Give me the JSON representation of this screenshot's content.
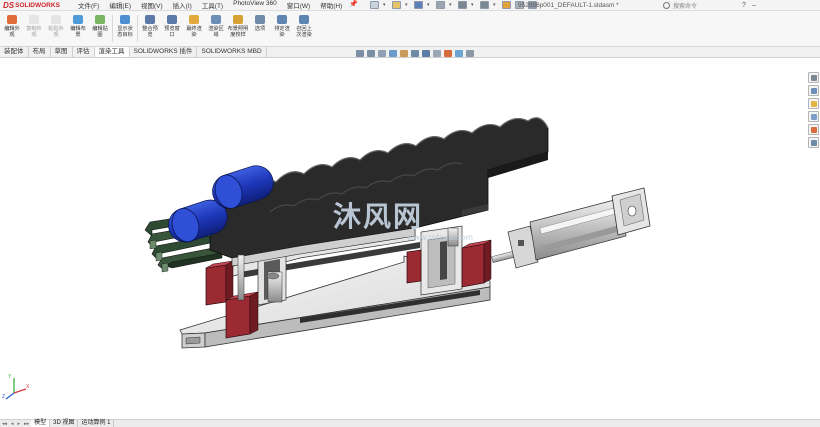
{
  "app": {
    "logo_ds": "DS",
    "logo_brand": "SOLIDWORKS",
    "document_title": "952006p001_DEFAULT-1.sldasm *",
    "search_placeholder": "搜索命令",
    "help_symbol": "?",
    "minimize_symbol": "–",
    "menu_pin_symbol": "📌"
  },
  "menu": [
    "文件(F)",
    "编辑(E)",
    "视图(V)",
    "插入(I)",
    "工具(T)",
    "PhotoView 360",
    "窗口(W)",
    "帮助(H)"
  ],
  "quick_access": [
    {
      "icon": "new-doc-icon",
      "color": "#c9d3de"
    },
    {
      "icon": "open-icon",
      "color": "#e7c36a"
    },
    {
      "icon": "save-icon",
      "color": "#5b7fb6"
    },
    {
      "icon": "print-icon",
      "color": "#9aa6b3"
    },
    {
      "icon": "undo-icon",
      "color": "#7b8793"
    },
    {
      "icon": "select-icon",
      "color": "#7b8793"
    },
    {
      "icon": "rebuild-icon",
      "color": "#e0a23a"
    },
    {
      "icon": "file-props-icon",
      "color": "#aab4bf"
    },
    {
      "icon": "options-icon",
      "color": "#8e9aa8"
    }
  ],
  "command_manager": [
    {
      "line1": "编辑外",
      "line2": "观",
      "icon": "edit-appearance-icon",
      "color": "#e06c3a",
      "enabled": true
    },
    {
      "line1": "复制外",
      "line2": "观",
      "icon": "copy-appearance-icon",
      "color": "#cfcfcf",
      "enabled": false
    },
    {
      "line1": "粘贴外",
      "line2": "观",
      "icon": "paste-appearance-icon",
      "color": "#cfcfcf",
      "enabled": false
    },
    {
      "line1": "编辑布",
      "line2": "景",
      "icon": "edit-scene-icon",
      "color": "#4f9bd9",
      "enabled": true
    },
    {
      "line1": "编辑贴",
      "line2": "图",
      "icon": "edit-decal-icon",
      "color": "#7bb661",
      "enabled": true
    },
    {
      "line1": "显示状",
      "line2": "态目标",
      "icon": "show-target-icon",
      "color": "#4d8fd1",
      "enabled": true
    },
    {
      "line1": "整合预",
      "line2": "览",
      "icon": "integrated-preview-icon",
      "color": "#5a79a8",
      "enabled": true
    },
    {
      "line1": "预览窗",
      "line2": "口",
      "icon": "preview-window-icon",
      "color": "#5a79a8",
      "enabled": true
    },
    {
      "line1": "最终渲",
      "line2": "染",
      "icon": "final-render-icon",
      "color": "#e2a93b",
      "enabled": true
    },
    {
      "line1": "渲染区",
      "line2": "域",
      "icon": "render-region-icon",
      "color": "#6c8fb8",
      "enabled": true
    },
    {
      "line1": "布景照明",
      "line2": "度校样",
      "icon": "scene-illumination-icon",
      "color": "#d7a233",
      "enabled": true
    },
    {
      "line1": "选项",
      "line2": "",
      "icon": "options-gear-icon",
      "color": "#6f8aa6",
      "enabled": true
    },
    {
      "line1": "排定渲",
      "line2": "染",
      "icon": "schedule-render-icon",
      "color": "#5f86b3",
      "enabled": true
    },
    {
      "line1": "召回上",
      "line2": "次渲染",
      "icon": "recall-render-icon",
      "color": "#5f86b3",
      "enabled": true
    }
  ],
  "tabs": [
    "装配体",
    "布局",
    "草图",
    "评估",
    "渲染工具",
    "SOLIDWORKS 插件",
    "SOLIDWORKS MBD"
  ],
  "active_tab": "渲染工具",
  "hud_icons": [
    {
      "icon": "zoom-fit-icon",
      "color": "#7b8fa6"
    },
    {
      "icon": "zoom-area-icon",
      "color": "#7b8fa6"
    },
    {
      "icon": "previous-view-icon",
      "color": "#8fa0b3"
    },
    {
      "icon": "section-view-icon",
      "color": "#6c9ac8"
    },
    {
      "icon": "dynamic-annotation-icon",
      "color": "#c89b5a"
    },
    {
      "icon": "view-orientation-icon",
      "color": "#6f8aa6"
    },
    {
      "icon": "display-style-icon",
      "color": "#5d7da6"
    },
    {
      "icon": "hide-show-icon",
      "color": "#9aa6b3"
    },
    {
      "icon": "edit-appearance-hud-icon",
      "color": "#d66c3c"
    },
    {
      "icon": "apply-scene-icon",
      "color": "#6ba4d3"
    },
    {
      "icon": "view-settings-icon",
      "color": "#8a98a8"
    }
  ],
  "task_pane": [
    {
      "icon": "home-icon",
      "color": "#7a8896"
    },
    {
      "icon": "design-library-icon",
      "color": "#6b8fb6"
    },
    {
      "icon": "file-explorer-icon",
      "color": "#e0b546"
    },
    {
      "icon": "view-palette-icon",
      "color": "#7aa0c8"
    },
    {
      "icon": "appearances-icon",
      "color": "#d86d3c"
    },
    {
      "icon": "custom-properties-icon",
      "color": "#6f8aa6"
    }
  ],
  "bottom_tabs": [
    "模型",
    "3D 视图",
    "运动算例 1"
  ],
  "active_bottom_tab": "模型",
  "bottom_nav": [
    "◂◂",
    "◂",
    "▸",
    "▸▸"
  ],
  "watermark": {
    "text": "沐风网",
    "url": "www.mfcad.com"
  },
  "triad": {
    "x": "X",
    "y": "Y",
    "z": "Z"
  }
}
